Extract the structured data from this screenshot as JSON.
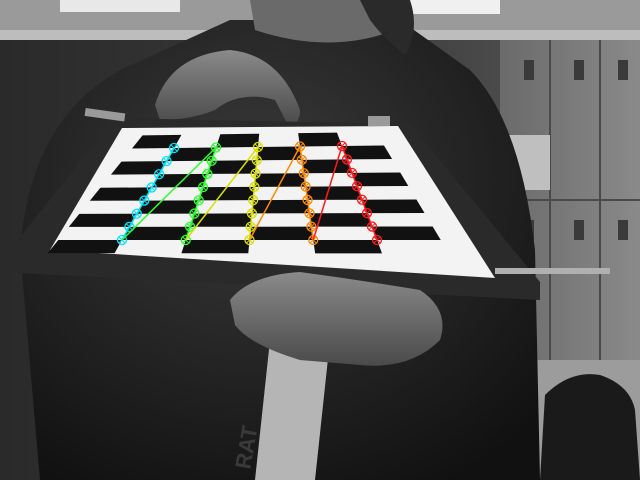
{
  "image": {
    "subject": "checkerboard",
    "rendering": "grayscale",
    "overlay_colors": [
      "#00e5ff",
      "#2bff2b",
      "#d8e000",
      "#ff8a00",
      "#ff1a1a"
    ]
  },
  "corner_grid": {
    "columns": 5,
    "rows": 8
  },
  "background_text": {
    "tube_mark": "RAT"
  }
}
